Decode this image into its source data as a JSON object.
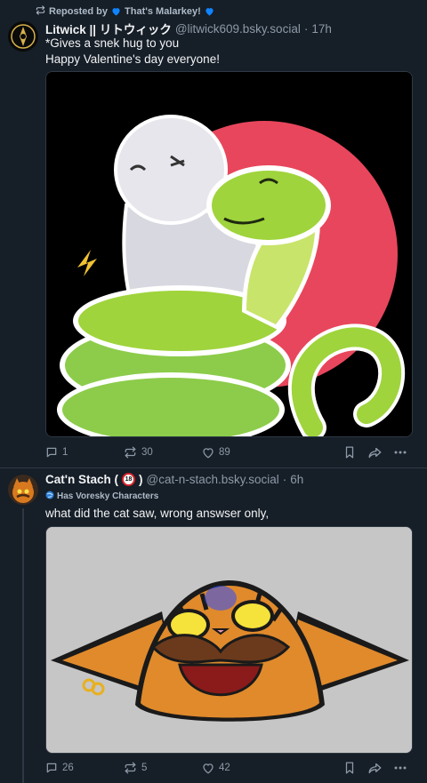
{
  "post1": {
    "repost_prefix": "Reposted by",
    "repost_by": "That's Malarkey!",
    "author_name": "Litwick || リトウィック",
    "author_handle": "@litwick609.bsky.social",
    "time_sep": "·",
    "time": "17h",
    "text_line1": "*Gives a snek hug to you",
    "text_line2": "Happy Valentine's day everyone!",
    "reply_count": "1",
    "repost_count": "30",
    "like_count": "89"
  },
  "post2": {
    "author_name": "Cat'n Stach (",
    "author_name_close": ")",
    "age_badge": "18",
    "author_handle": "@cat-n-stach.bsky.social",
    "time_sep": "·",
    "time": "6h",
    "label": "Has Voresky Characters",
    "text": "what did the cat saw, wrong answser only,",
    "reply_count": "26",
    "repost_count": "5",
    "like_count": "42"
  },
  "colors": {
    "background": "#161e27",
    "border": "#2e3945",
    "muted_text": "#8d9aa8",
    "accent_blue": "#1083fe"
  },
  "icons": [
    "repost-icon",
    "heart-icon",
    "reply-icon",
    "like-icon",
    "bookmark-icon",
    "share-icon",
    "more-icon"
  ]
}
